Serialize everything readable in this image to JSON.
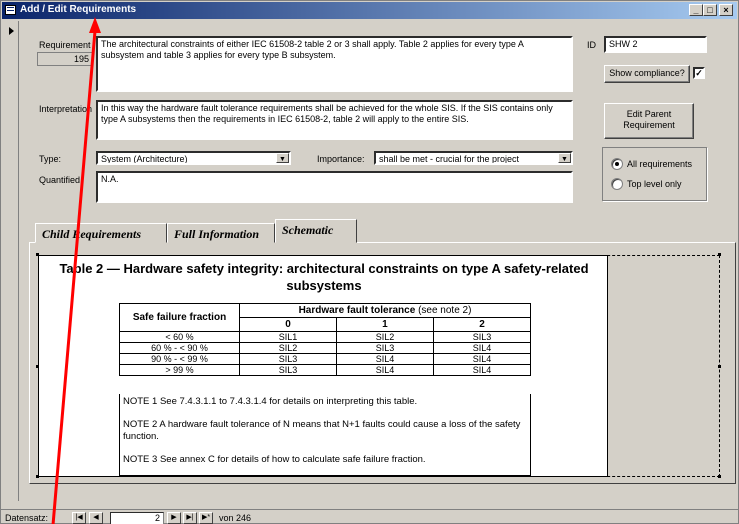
{
  "window": {
    "title": "Add / Edit Requirements",
    "minimize": "_",
    "maximize": "□",
    "close": "×"
  },
  "form": {
    "requirement_label": "Requirement",
    "requirement_number": "195",
    "requirement_text": "The architectural constraints of either IEC 61508-2 table 2 or 3 shall apply. Table 2 applies for every type A subsystem and table 3 applies for every type B subsystem.",
    "id_label": "ID",
    "id_value": "SHW 2",
    "show_compliance_label": "Show compliance?",
    "show_compliance_checked": "✓",
    "interpretation_label": "Interpretation",
    "interpretation_text": "In this way the hardware fault tolerance requirements shall be achieved for the whole SIS. If the SIS contains only type A subsystems then the requirements in IEC 61508-2, table 2 will apply to the entire SIS.",
    "edit_parent_label": "Edit Parent Requirement",
    "type_label": "Type:",
    "type_value": "System (Architecture)",
    "importance_label": "Importance:",
    "importance_value": "shall be met - crucial for the project",
    "quantified_label": "Quantified",
    "quantified_value": "N.A.",
    "filter_options": [
      "All requirements",
      "Top level only"
    ],
    "filter_selected": "All requirements"
  },
  "tabs": [
    {
      "label": "Child Requirements"
    },
    {
      "label": "Full Information"
    },
    {
      "label": "Schematic",
      "active": true
    }
  ],
  "schematic": {
    "title_line1": "Table 2 — Hardware safety integrity: architectural constraints on type A safety-related",
    "title_line2": "subsystems",
    "col_header_sff": "Safe failure fraction",
    "col_header_hft": "Hardware fault tolerance",
    "col_header_hft_note": "(see note 2)",
    "hft_levels": [
      "0",
      "1",
      "2"
    ],
    "rows": [
      {
        "sff": "< 60 %",
        "values": [
          "SIL1",
          "SIL2",
          "SIL3"
        ]
      },
      {
        "sff": "60 % - < 90 %",
        "values": [
          "SIL2",
          "SIL3",
          "SIL4"
        ]
      },
      {
        "sff": "90 % - < 99 %",
        "values": [
          "SIL3",
          "SIL4",
          "SIL4"
        ]
      },
      {
        "sff": "> 99 %",
        "values": [
          "SIL3",
          "SIL4",
          "SIL4"
        ]
      }
    ],
    "note1": "NOTE 1   See 7.4.3.1.1 to 7.4.3.1.4 for details on interpreting this table.",
    "note2": "NOTE 2   A hardware fault tolerance of N means that N+1 faults could cause a loss of the safety function.",
    "note3": "NOTE 3   See annex C for details of how to calculate safe failure fraction."
  },
  "navigation": {
    "record_label": "Datensatz:",
    "current_record": "2",
    "total_label": "von  246",
    "first": "|◀",
    "prev": "◀",
    "next": "▶",
    "last": "▶|",
    "new": "▶*"
  }
}
